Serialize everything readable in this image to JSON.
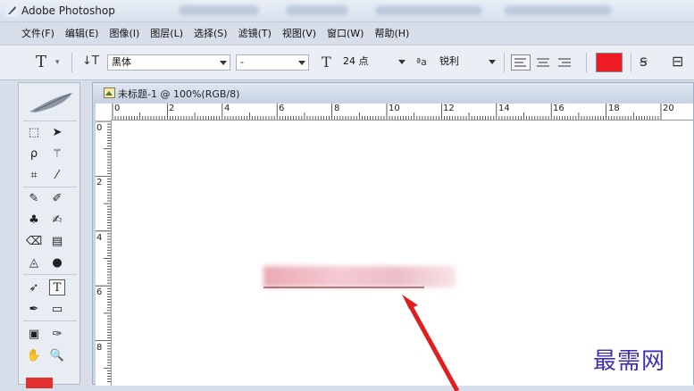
{
  "app": {
    "title": "Adobe Photoshop"
  },
  "menu": [
    "文件(F)",
    "编辑(E)",
    "图像(I)",
    "图层(L)",
    "选择(S)",
    "滤镜(T)",
    "视图(V)",
    "窗口(W)",
    "帮助(H)"
  ],
  "options": {
    "tool_glyph": "T",
    "orientation_glyph": "↓T",
    "font_family": "黑体",
    "font_style": "-",
    "size_glyph": "T",
    "font_size": "24 点",
    "aa_glyph": "ªa",
    "antialias": "锐利",
    "text_color": "#ee1c24"
  },
  "document": {
    "title": "未标题-1 @ 100%(RGB/8)",
    "ruler_h": [
      "0",
      "2",
      "4",
      "6",
      "8",
      "10",
      "12",
      "14",
      "16",
      "18",
      "20"
    ],
    "ruler_v": [
      "0",
      "2",
      "4",
      "6",
      "8"
    ]
  },
  "watermark": "最需网"
}
